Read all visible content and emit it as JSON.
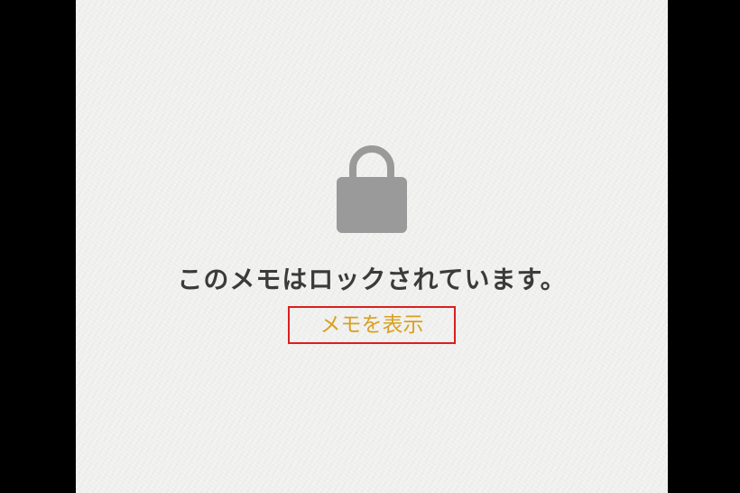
{
  "lock_screen": {
    "icon": "lock-icon",
    "message": "このメモはロックされています。",
    "show_note_label": "メモを表示"
  },
  "colors": {
    "background": "#f1f1f0",
    "lock_icon": "#9a9a9a",
    "message_text": "#3b3b3b",
    "link_text": "#d9a021",
    "highlight_box": "#dc1e1e"
  }
}
